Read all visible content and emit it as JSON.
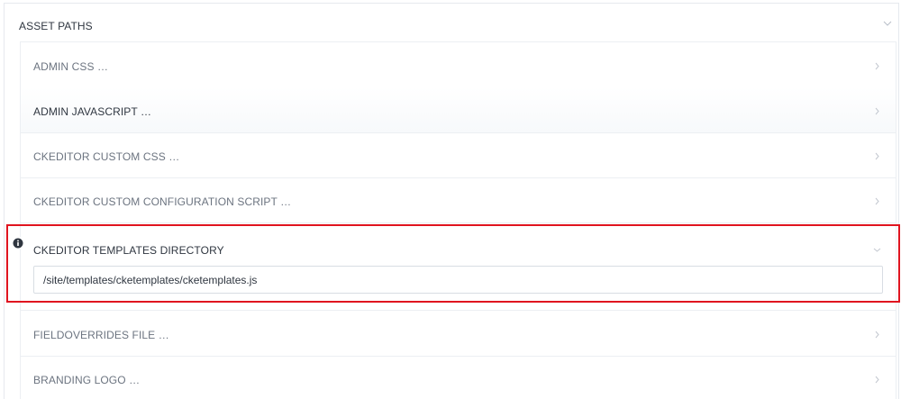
{
  "section": {
    "title": "ASSET PATHS",
    "toggle_icon": "chevron-down-icon"
  },
  "rows": [
    {
      "label": "ADMIN CSS …",
      "icon": "chevron-right-icon"
    },
    {
      "label": "ADMIN JAVASCRIPT …",
      "icon": "chevron-right-icon"
    },
    {
      "label": "CKEDITOR CUSTOM CSS …",
      "icon": "chevron-right-icon"
    },
    {
      "label": "CKEDITOR CUSTOM CONFIGURATION SCRIPT …",
      "icon": "chevron-right-icon"
    },
    {
      "label": "CKEDITOR TEMPLATES DIRECTORY",
      "icon": "chevron-down-icon",
      "value": "/site/templates/cketemplates/cketemplates.js",
      "info_icon": "info-icon"
    },
    {
      "label": "FIELDOVERRIDES FILE …",
      "icon": "chevron-right-icon"
    },
    {
      "label": "BRANDING LOGO …",
      "icon": "chevron-right-icon"
    }
  ],
  "highlight_color": "#e0141f"
}
